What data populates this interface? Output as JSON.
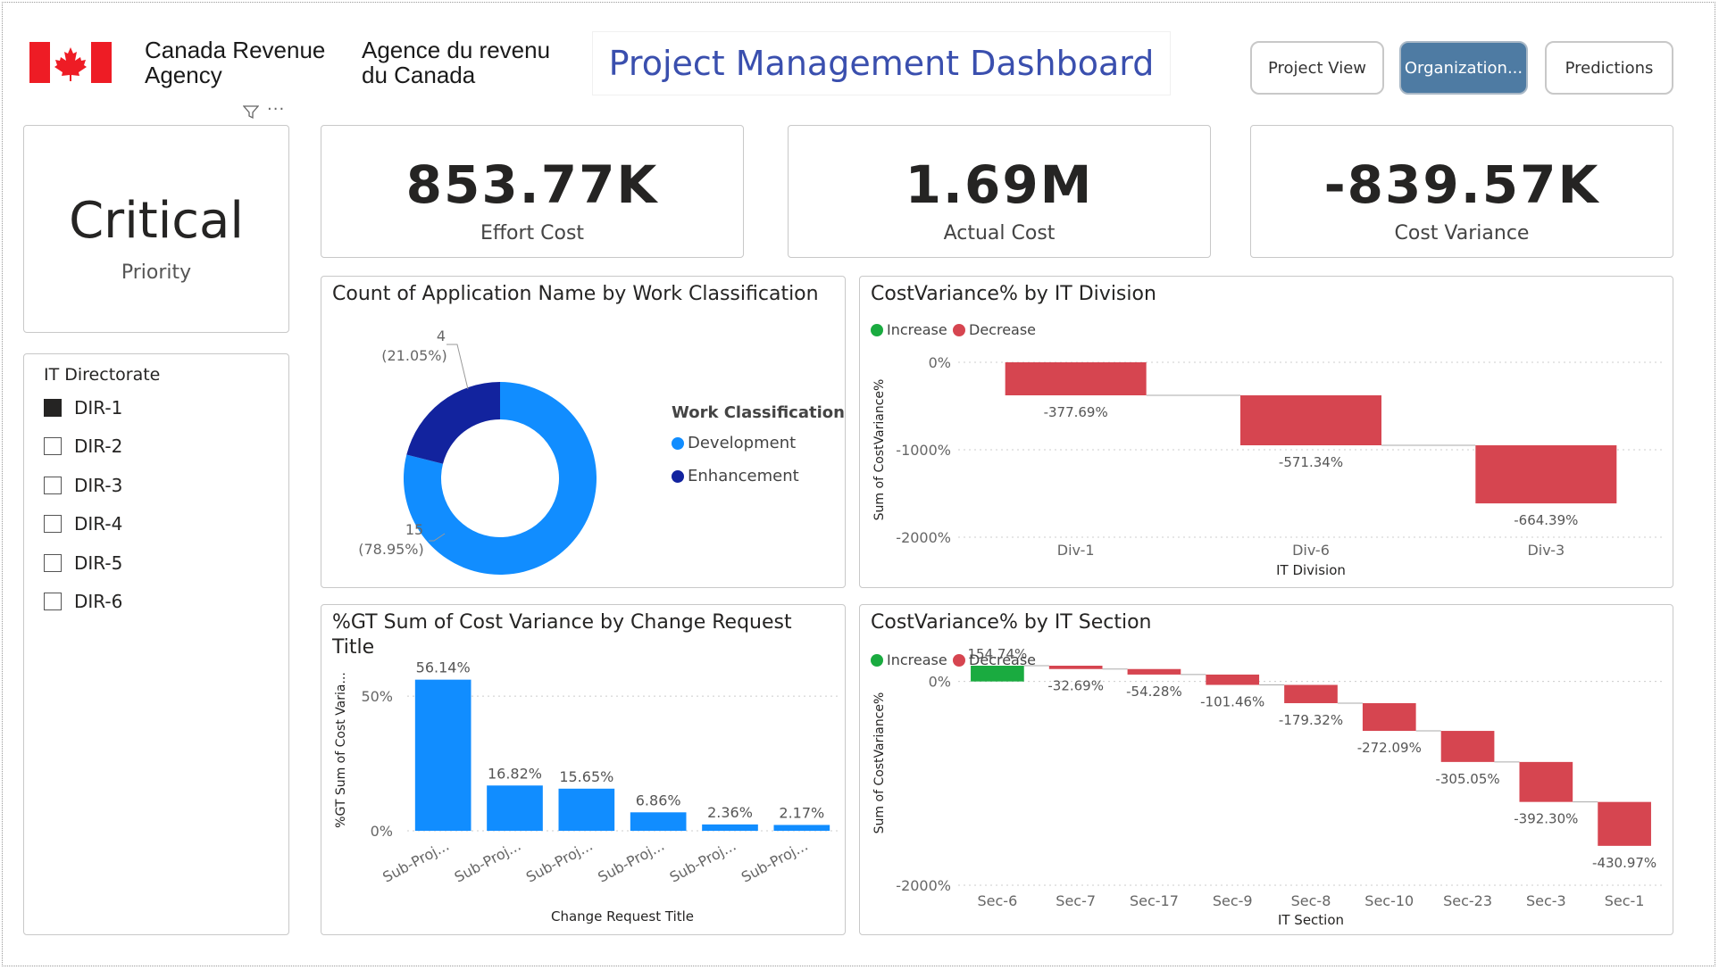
{
  "header": {
    "agency_en": [
      "Canada Revenue",
      "Agency"
    ],
    "agency_fr": [
      "Agence du revenu",
      "du Canada"
    ],
    "dashboard_title": "Project Management Dashboard",
    "nav": [
      {
        "label": "Project View",
        "active": false
      },
      {
        "label": "Organization...",
        "active": true
      },
      {
        "label": "Predictions",
        "active": false
      }
    ],
    "flag_color": "#ee1c25"
  },
  "priority_card": {
    "value": "Critical",
    "label": "Priority"
  },
  "kpis": [
    {
      "value": "853.77K",
      "label": "Effort Cost"
    },
    {
      "value": "1.69M",
      "label": "Actual Cost"
    },
    {
      "value": "-839.57K",
      "label": "Cost Variance"
    }
  ],
  "slicer": {
    "title": "IT Directorate",
    "items": [
      {
        "label": "DIR-1",
        "checked": true
      },
      {
        "label": "DIR-2",
        "checked": false
      },
      {
        "label": "DIR-3",
        "checked": false
      },
      {
        "label": "DIR-4",
        "checked": false
      },
      {
        "label": "DIR-5",
        "checked": false
      },
      {
        "label": "DIR-6",
        "checked": false
      }
    ]
  },
  "colors": {
    "increase": "#1aab40",
    "decrease": "#d64550",
    "development": "#118dff",
    "enhancement": "#12239e"
  },
  "waterfall_legend": {
    "increase": "Increase",
    "decrease": "Decrease"
  },
  "chart_data": [
    {
      "id": "donut",
      "type": "pie",
      "title": "Count of Application Name by Work Classification",
      "legend_title": "Work Classification",
      "categories": [
        "Development",
        "Enhancement"
      ],
      "values": [
        15,
        4
      ],
      "labels": [
        [
          "15",
          "(78.95%)"
        ],
        [
          "4",
          "(21.05%)"
        ]
      ]
    },
    {
      "id": "division",
      "type": "bar",
      "subtype": "waterfall",
      "title": "CostVariance% by IT Division",
      "xlabel": "IT Division",
      "ylabel": "Sum of CostVariance%",
      "categories": [
        "Div-1",
        "Div-6",
        "Div-3"
      ],
      "values": [
        -377.69,
        -571.34,
        -664.39
      ],
      "data_labels": [
        "-377.69%",
        "-571.34%",
        "-664.39%"
      ],
      "yticks": [
        0,
        -1000,
        -2000
      ],
      "ytick_labels": [
        "0%",
        "-1000%",
        "-2000%"
      ],
      "ylim": [
        -2000,
        0
      ]
    },
    {
      "id": "crt",
      "type": "bar",
      "title": "%GT Sum of Cost Variance by Change Request Title",
      "xlabel": "Change Request Title",
      "ylabel": "%GT Sum of Cost Varia...",
      "categories": [
        "Sub-Proj...",
        "Sub-Proj...",
        "Sub-Proj...",
        "Sub-Proj...",
        "Sub-Proj...",
        "Sub-Proj..."
      ],
      "values": [
        56.14,
        16.82,
        15.65,
        6.86,
        2.36,
        2.17
      ],
      "data_labels": [
        "56.14%",
        "16.82%",
        "15.65%",
        "6.86%",
        "2.36%",
        "2.17%"
      ],
      "yticks": [
        0,
        50
      ],
      "ytick_labels": [
        "0%",
        "50%"
      ],
      "ylim": [
        0,
        60
      ]
    },
    {
      "id": "section",
      "type": "bar",
      "subtype": "waterfall",
      "title": "CostVariance% by IT Section",
      "xlabel": "IT Section",
      "ylabel": "Sum of CostVariance%",
      "categories": [
        "Sec-6",
        "Sec-7",
        "Sec-17",
        "Sec-9",
        "Sec-8",
        "Sec-10",
        "Sec-23",
        "Sec-3",
        "Sec-1"
      ],
      "values": [
        154.74,
        -32.69,
        -54.28,
        -101.46,
        -179.32,
        -272.09,
        -305.05,
        -392.3,
        -430.97
      ],
      "data_labels": [
        "154.74%",
        "-32.69%",
        "-54.28%",
        "-101.46%",
        "-179.32%",
        "-272.09%",
        "-305.05%",
        "-392.30%",
        "-430.97%"
      ],
      "yticks": [
        0,
        -2000
      ],
      "ytick_labels": [
        "0%",
        "-2000%"
      ],
      "ylim": [
        -2000,
        400
      ]
    }
  ]
}
